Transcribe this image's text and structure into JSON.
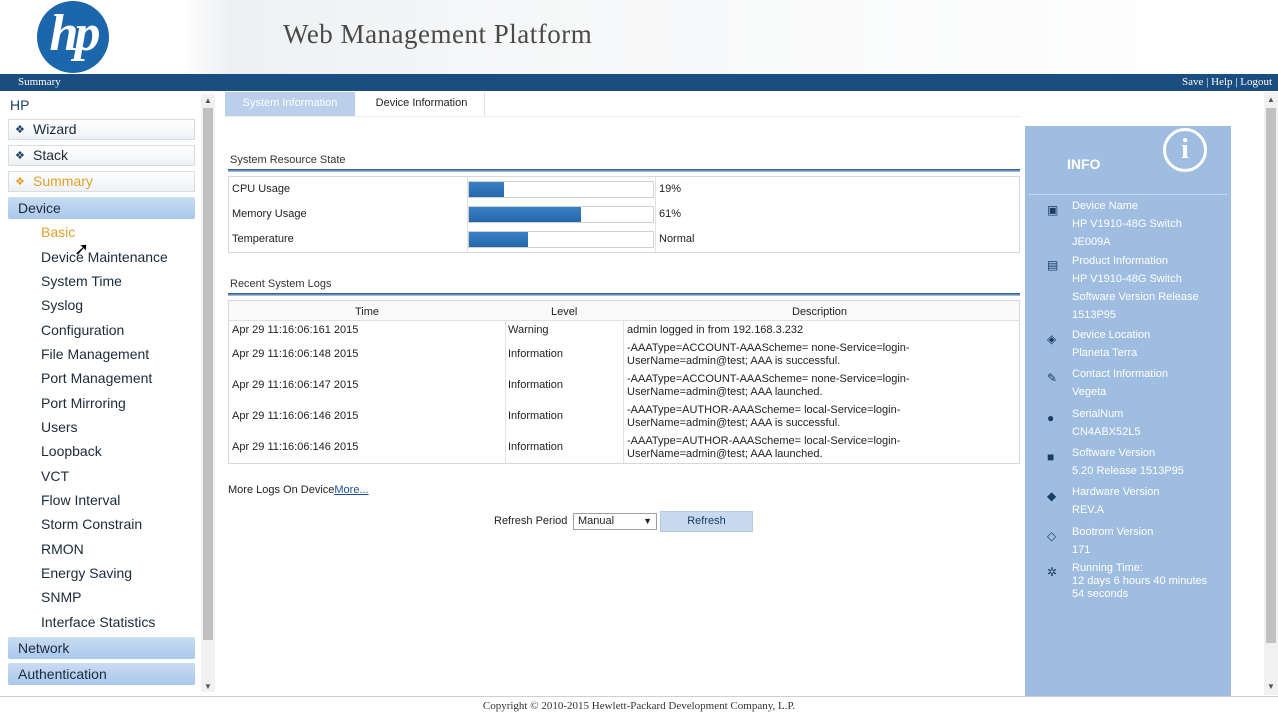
{
  "header": {
    "logo_text": "hp",
    "title": "Web Management Platform"
  },
  "topbar": {
    "breadcrumb": "Summary",
    "save": "Save",
    "sep1": "|",
    "help": "Help",
    "sep2": "|",
    "logout": "Logout"
  },
  "sidebar": {
    "root": "HP",
    "top_items": [
      "Wizard",
      "Stack",
      "Summary"
    ],
    "device": "Device",
    "device_items": [
      "Basic",
      "Device Maintenance",
      "System Time",
      "Syslog",
      "Configuration",
      "File Management",
      "Port Management",
      "Port Mirroring",
      "Users",
      "Loopback",
      "VCT",
      "Flow Interval",
      "Storm Constrain",
      "RMON",
      "Energy Saving",
      "SNMP",
      "Interface Statistics"
    ],
    "network": "Network",
    "authentication": "Authentication"
  },
  "tabs": {
    "system_information": "System Information",
    "device_information": "Device Information"
  },
  "resource": {
    "title": "System Resource State",
    "rows": [
      {
        "label": "CPU Usage",
        "percent": 19,
        "value": "19%"
      },
      {
        "label": "Memory Usage",
        "percent": 61,
        "value": "61%"
      },
      {
        "label": "Temperature",
        "percent": 32,
        "value": "Normal"
      }
    ]
  },
  "logs": {
    "title": "Recent System Logs",
    "columns": {
      "time": "Time",
      "level": "Level",
      "description": "Description"
    },
    "rows": [
      {
        "time": "Apr 29 11:16:06:161 2015",
        "level": "Warning",
        "desc1": "admin logged in from 192.168.3.232",
        "desc2": ""
      },
      {
        "time": "Apr 29 11:16:06:148 2015",
        "level": "Information",
        "desc1": "-AAAType=ACCOUNT-AAAScheme= none-Service=login-",
        "desc2": "UserName=admin@test; AAA is successful."
      },
      {
        "time": "Apr 29 11:16:06:147 2015",
        "level": "Information",
        "desc1": "-AAAType=ACCOUNT-AAAScheme= none-Service=login-",
        "desc2": "UserName=admin@test; AAA launched."
      },
      {
        "time": "Apr 29 11:16:06:146 2015",
        "level": "Information",
        "desc1": "-AAAType=AUTHOR-AAAScheme= local-Service=login-",
        "desc2": "UserName=admin@test; AAA is successful."
      },
      {
        "time": "Apr 29 11:16:06:146 2015",
        "level": "Information",
        "desc1": "-AAAType=AUTHOR-AAAScheme= local-Service=login-",
        "desc2": "UserName=admin@test; AAA launched."
      }
    ]
  },
  "more_logs": {
    "text": "More Logs On Device",
    "link": "More..."
  },
  "refresh": {
    "label": "Refresh Period",
    "selected": "Manual",
    "button": "Refresh"
  },
  "info": {
    "title": "INFO",
    "entries": [
      {
        "icon": "switch-icon",
        "glyph": "▣",
        "lines": [
          "Device Name",
          "HP V1910-48G Switch",
          "JE009A"
        ]
      },
      {
        "icon": "product-icon",
        "glyph": "▤",
        "lines": [
          "Product Information",
          "HP V1910-48G Switch",
          "Software Version Release",
          "1513P95"
        ]
      },
      {
        "icon": "location-icon",
        "glyph": "◈",
        "lines": [
          "Device Location",
          "Planeta Terra"
        ]
      },
      {
        "icon": "contact-icon",
        "glyph": "✎",
        "lines": [
          "Contact Information",
          "Vegeta"
        ]
      },
      {
        "icon": "serial-icon",
        "glyph": "●",
        "lines": [
          "SerialNum",
          "CN4ABX52L5"
        ]
      },
      {
        "icon": "software-icon",
        "glyph": "■",
        "lines": [
          "Software Version",
          "5.20 Release 1513P95"
        ]
      },
      {
        "icon": "hardware-icon",
        "glyph": "◆",
        "lines": [
          "Hardware Version",
          "REV.A"
        ]
      },
      {
        "icon": "bootrom-icon",
        "glyph": "◇",
        "lines": [
          "Bootrom Version",
          "171"
        ]
      },
      {
        "icon": "running-time-icon",
        "glyph": "✲",
        "lines": [
          "Running Time:",
          "12 days 6 hours 40 minutes",
          "54 seconds"
        ]
      }
    ]
  },
  "footer": "Copyright © 2010-2015 Hewlett-Packard Development Company, L.P."
}
